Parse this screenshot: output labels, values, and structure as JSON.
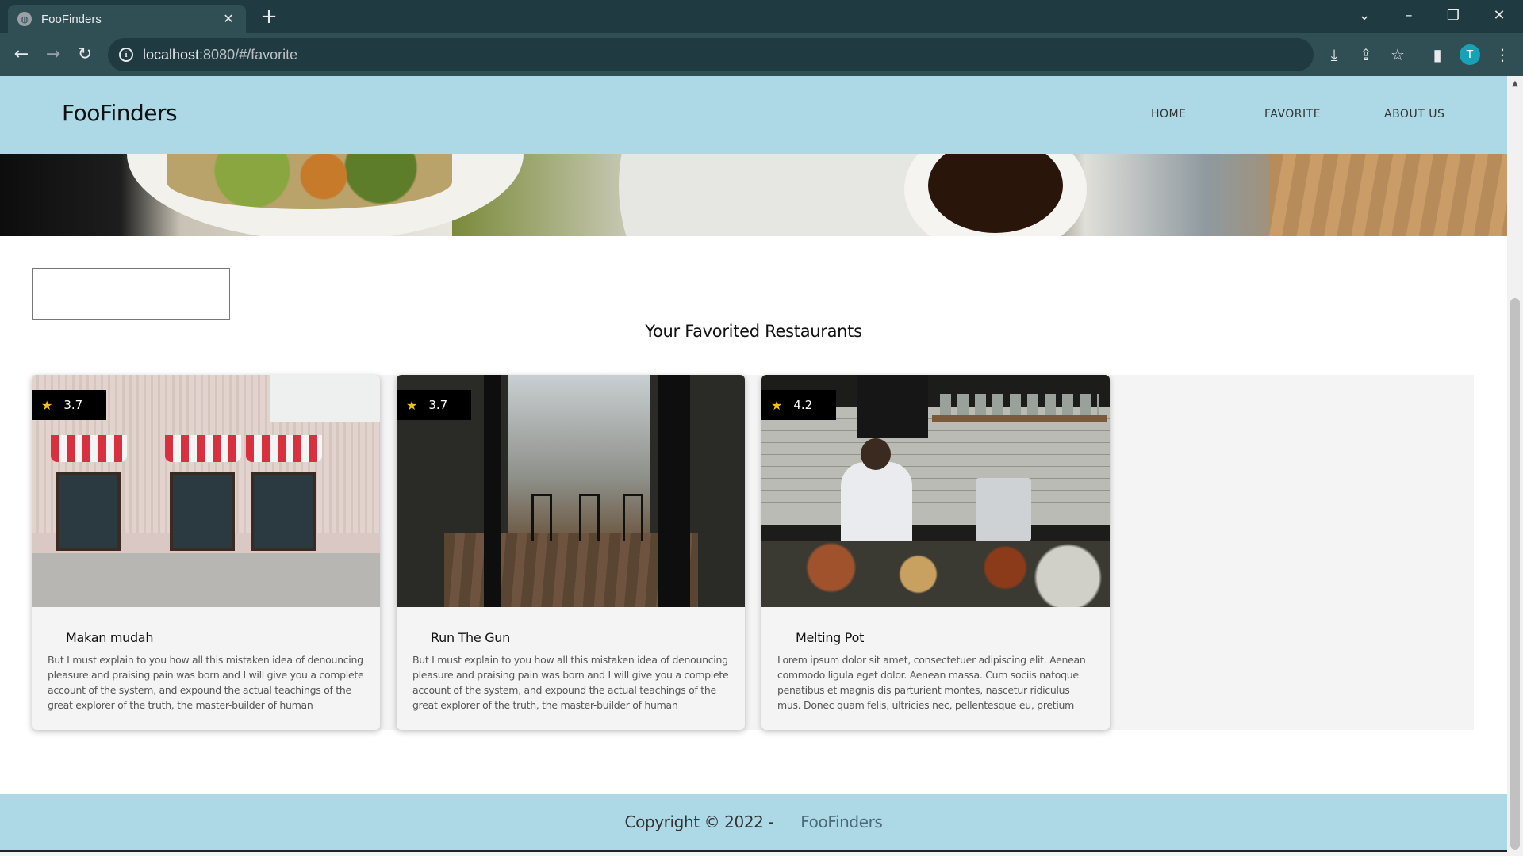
{
  "browser": {
    "tab_title": "FooFinders",
    "url_host": "localhost",
    "url_rest": ":8080/#/favorite",
    "profile_initial": "T"
  },
  "header": {
    "brand": "FooFinders",
    "nav": [
      {
        "label": "HOME"
      },
      {
        "label": "FAVORITE"
      },
      {
        "label": "ABOUT US"
      }
    ]
  },
  "search": {
    "value": ""
  },
  "main": {
    "title": "Your Favorited Restaurants",
    "restaurants": [
      {
        "name": "Makan mudah",
        "rating": "3.7",
        "description": "But I must explain to you how all this mistaken idea of denouncing pleasure and praising pain was born and I will give you a complete account of the system, and expound the actual teachings of the great explorer of the truth, the master-builder of human happiness. No one..."
      },
      {
        "name": "Run The Gun",
        "rating": "3.7",
        "description": "But I must explain to you how all this mistaken idea of denouncing pleasure and praising pain was born and I will give you a complete account of the system, and expound the actual teachings of the great explorer of the truth, the master-builder of human happiness. No one..."
      },
      {
        "name": "Melting Pot",
        "rating": "4.2",
        "description": "Lorem ipsum dolor sit amet, consectetuer adipiscing elit. Aenean commodo ligula eget dolor. Aenean massa. Cum sociis natoque penatibus et magnis dis parturient montes, nascetur ridiculus mus. Donec quam felis, ultricies nec, pellentesque eu, pretium quis, sem..."
      }
    ]
  },
  "footer": {
    "copyright": "Copyright © 2022 -",
    "brand": "FooFinders"
  },
  "icons": [
    "globe-icon",
    "close-icon",
    "plus-icon",
    "chevron-down-icon",
    "minimize-icon",
    "restore-icon",
    "back-icon",
    "forward-icon",
    "reload-icon",
    "info-icon",
    "install-icon",
    "share-icon",
    "star-icon",
    "sidepanel-icon",
    "more-icon"
  ],
  "colors": {
    "header_bg": "#add8e6",
    "rating_star": "#f0c020",
    "chrome_bg": "#2f4f55"
  }
}
